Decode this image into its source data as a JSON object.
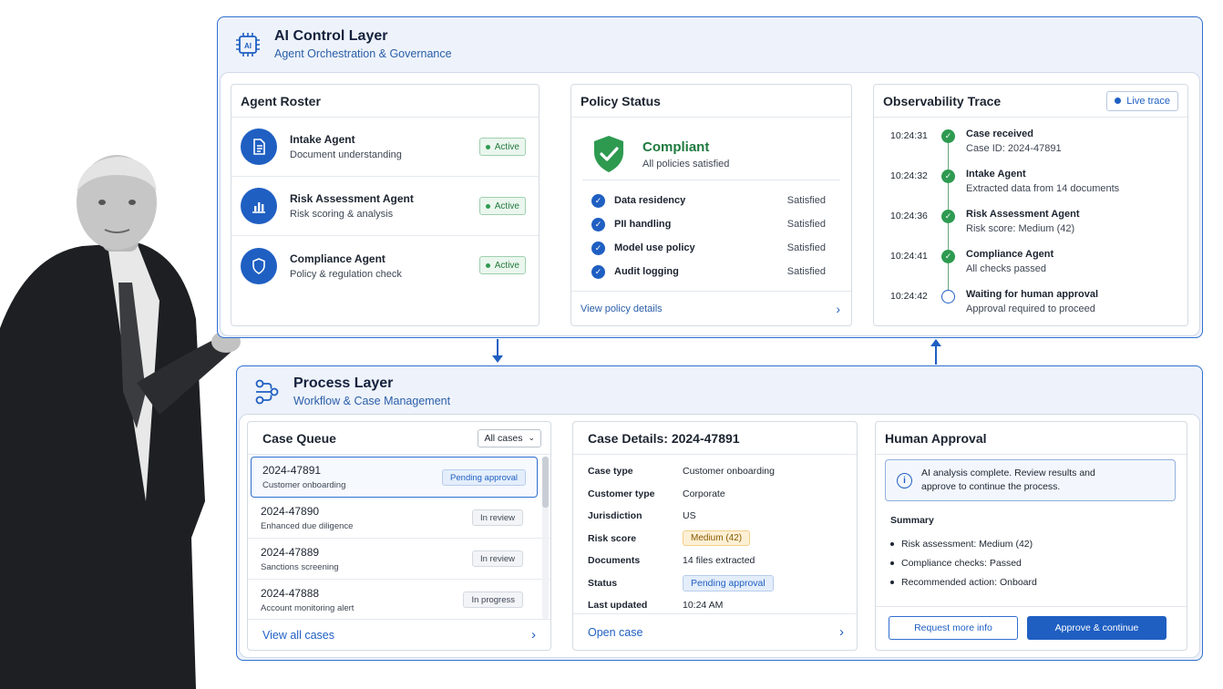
{
  "colors": {
    "accent": "#1f5fc2",
    "success": "#2e9a50",
    "warning": "#f0cf88",
    "layer_bg": "#eef3fb"
  },
  "ai_layer": {
    "icon": "ai-chip-icon",
    "title": "AI Control Layer",
    "subtitle": "Agent Orchestration & Governance"
  },
  "agent_roster": {
    "title": "Agent Roster",
    "agents": [
      {
        "name": "Intake Agent",
        "desc": "Document understanding",
        "status": "Active",
        "icon": "document-icon"
      },
      {
        "name": "Risk Assessment Agent",
        "desc": "Risk scoring & analysis",
        "status": "Active",
        "icon": "bar-chart-icon"
      },
      {
        "name": "Compliance Agent",
        "desc": "Policy & regulation check",
        "status": "Active",
        "icon": "shield-icon"
      }
    ]
  },
  "policy_status": {
    "title": "Policy Status",
    "summary_title": "Compliant",
    "summary_sub": "All policies satisfied",
    "policies": [
      {
        "name": "Data residency",
        "status": "Satisfied"
      },
      {
        "name": "PII handling",
        "status": "Satisfied"
      },
      {
        "name": "Model use policy",
        "status": "Satisfied"
      },
      {
        "name": "Audit logging",
        "status": "Satisfied"
      }
    ],
    "link": "View policy details"
  },
  "observability": {
    "title": "Observability Trace",
    "live_label": "Live trace",
    "events": [
      {
        "time": "10:24:31",
        "title": "Case received",
        "sub": "Case ID: 2024-47891",
        "done": true
      },
      {
        "time": "10:24:32",
        "title": "Intake Agent",
        "sub": "Extracted data from 14 documents",
        "done": true
      },
      {
        "time": "10:24:36",
        "title": "Risk Assessment Agent",
        "sub": "Risk score: Medium (42)",
        "done": true
      },
      {
        "time": "10:24:41",
        "title": "Compliance Agent",
        "sub": "All checks passed",
        "done": true
      },
      {
        "time": "10:24:42",
        "title": "Waiting for human approval",
        "sub": "Approval required to proceed",
        "done": false
      }
    ]
  },
  "process_layer": {
    "icon": "workflow-icon",
    "title": "Process Layer",
    "subtitle": "Workflow & Case Management"
  },
  "case_queue": {
    "title": "Case Queue",
    "filter": "All cases",
    "cases": [
      {
        "id": "2024-47891",
        "type": "Customer onboarding",
        "status": "Pending approval"
      },
      {
        "id": "2024-47890",
        "type": "Enhanced due diligence",
        "status": "In review"
      },
      {
        "id": "2024-47889",
        "type": "Sanctions screening",
        "status": "In review"
      },
      {
        "id": "2024-47888",
        "type": "Account monitoring alert",
        "status": "In progress"
      }
    ],
    "link": "View all cases"
  },
  "case_details": {
    "title": "Case Details: 2024-47891",
    "rows": {
      "case_type_label": "Case type",
      "case_type": "Customer onboarding",
      "customer_type_label": "Customer type",
      "customer_type": "Corporate",
      "jurisdiction_label": "Jurisdiction",
      "jurisdiction": "US",
      "risk_label": "Risk score",
      "risk": "Medium (42)",
      "documents_label": "Documents",
      "documents": "14 files extracted",
      "status_label": "Status",
      "status": "Pending approval",
      "updated_label": "Last updated",
      "updated": "10:24 AM"
    },
    "link": "Open case"
  },
  "human_approval": {
    "title": "Human Approval",
    "info": "AI analysis complete. Review results and approve to continue the process.",
    "summary_title": "Summary",
    "summary": [
      "Risk assessment: Medium (42)",
      "Compliance checks: Passed",
      "Recommended action: Onboard"
    ],
    "secondary_button": "Request more info",
    "primary_button": "Approve & continue"
  }
}
